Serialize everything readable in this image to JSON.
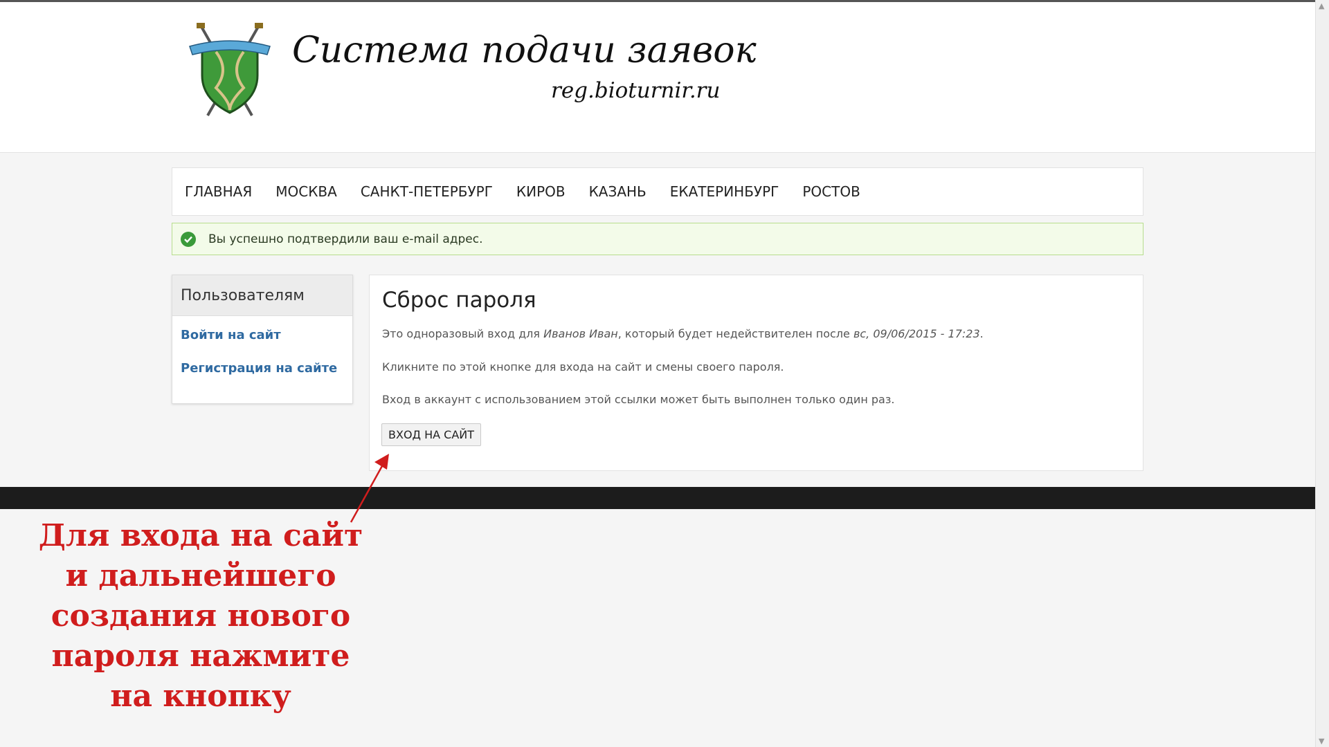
{
  "header": {
    "title": "Система подачи заявок",
    "url": "reg.bioturnir.ru",
    "logo_icon": "shield-logo-icon"
  },
  "nav": {
    "items": [
      {
        "label": "ГЛАВНАЯ"
      },
      {
        "label": "МОСКВА"
      },
      {
        "label": "САНКТ-ПЕТЕРБУРГ"
      },
      {
        "label": "КИРОВ"
      },
      {
        "label": "КАЗАНЬ"
      },
      {
        "label": "ЕКАТЕРИНБУРГ"
      },
      {
        "label": "РОСТОВ"
      }
    ]
  },
  "alert": {
    "text": "Вы успешно подтвердили ваш e-mail адрес.",
    "icon": "check-circle-icon",
    "color": "#3a9a3a"
  },
  "sidebar": {
    "title": "Пользователям",
    "links": [
      {
        "label": "Войти на сайт"
      },
      {
        "label": "Регистрация на сайте"
      }
    ]
  },
  "main": {
    "title": "Сброс пароля",
    "p1_prefix": "Это одноразовый вход для ",
    "p1_user": "Иванов Иван",
    "p1_middle": ", который будет недействителен после ",
    "p1_date": "вс, 09/06/2015 - 17:23",
    "p1_suffix": ".",
    "p2": "Кликните по этой кнопке для входа на сайт и смены своего пароля.",
    "p3": "Вход в аккаунт с использованием этой ссылки может быть выполнен только один раз.",
    "button_label": "ВХОД НА САЙТ"
  },
  "annotation": {
    "lines": [
      "Для входа на сайт",
      "и дальнейшего",
      "создания нового",
      "пароля нажмите",
      "на кнопку"
    ],
    "color": "#d01d1d"
  }
}
